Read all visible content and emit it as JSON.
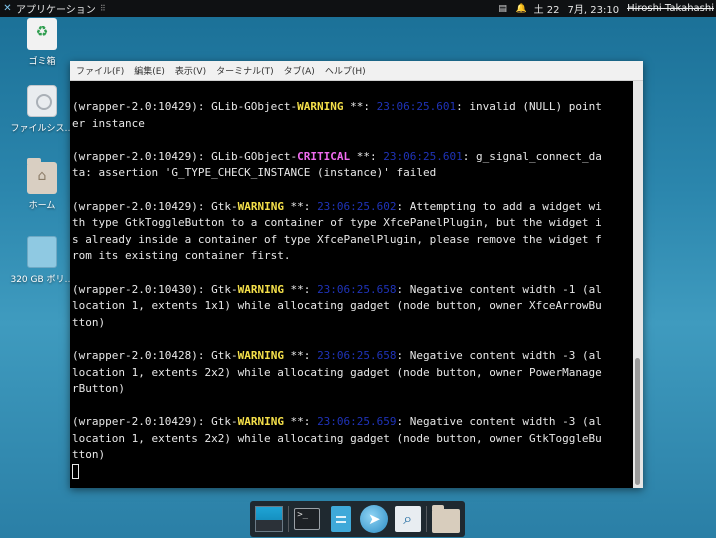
{
  "top_panel": {
    "apps_label": "アプリケーション",
    "workspace_label": "土 22",
    "clock": "7月, 23:10",
    "user": "Hiroshi Takahashi"
  },
  "desktop_icons": [
    {
      "label": "ゴミ箱",
      "icon": "trash-icon"
    },
    {
      "label": "ファイルシス…",
      "icon": "drive-icon"
    },
    {
      "label": "ホーム",
      "icon": "home-folder-icon"
    },
    {
      "label": "320 GB ボリ…",
      "icon": "volume-icon"
    }
  ],
  "terminal": {
    "menu": [
      "ファイル(F)",
      "編集(E)",
      "表示(V)",
      "ターミナル(T)",
      "タブ(A)",
      "ヘルプ(H)"
    ],
    "lines": [
      [
        {
          "t": "(wrapper-2.0:10429): GLib-GObject-"
        },
        {
          "t": "WARNING",
          "c": "warn"
        },
        {
          "t": " **: "
        },
        {
          "t": "23:06:25.601",
          "c": "ts"
        },
        {
          "t": ": invalid (NULL) point"
        }
      ],
      [
        {
          "t": "er instance"
        }
      ],
      [
        {
          "t": ""
        }
      ],
      [
        {
          "t": "(wrapper-2.0:10429): GLib-GObject-"
        },
        {
          "t": "CRITICAL",
          "c": "crit"
        },
        {
          "t": " **: "
        },
        {
          "t": "23:06:25.601",
          "c": "ts"
        },
        {
          "t": ": g_signal_connect_da"
        }
      ],
      [
        {
          "t": "ta: assertion 'G_TYPE_CHECK_INSTANCE (instance)' failed"
        }
      ],
      [
        {
          "t": ""
        }
      ],
      [
        {
          "t": "(wrapper-2.0:10429): Gtk-"
        },
        {
          "t": "WARNING",
          "c": "warn"
        },
        {
          "t": " **: "
        },
        {
          "t": "23:06:25.602",
          "c": "ts"
        },
        {
          "t": ": Attempting to add a widget wi"
        }
      ],
      [
        {
          "t": "th type GtkToggleButton to a container of type XfcePanelPlugin, but the widget i"
        }
      ],
      [
        {
          "t": "s already inside a container of type XfcePanelPlugin, please remove the widget f"
        }
      ],
      [
        {
          "t": "rom its existing container first."
        }
      ],
      [
        {
          "t": ""
        }
      ],
      [
        {
          "t": "(wrapper-2.0:10430): Gtk-"
        },
        {
          "t": "WARNING",
          "c": "warn"
        },
        {
          "t": " **: "
        },
        {
          "t": "23:06:25.658",
          "c": "ts"
        },
        {
          "t": ": Negative content width -1 (al"
        }
      ],
      [
        {
          "t": "location 1, extents 1x1) while allocating gadget (node button, owner XfceArrowBu"
        }
      ],
      [
        {
          "t": "tton)"
        }
      ],
      [
        {
          "t": ""
        }
      ],
      [
        {
          "t": "(wrapper-2.0:10428): Gtk-"
        },
        {
          "t": "WARNING",
          "c": "warn"
        },
        {
          "t": " **: "
        },
        {
          "t": "23:06:25.658",
          "c": "ts"
        },
        {
          "t": ": Negative content width -3 (al"
        }
      ],
      [
        {
          "t": "location 1, extents 2x2) while allocating gadget (node button, owner PowerManage"
        }
      ],
      [
        {
          "t": "rButton)"
        }
      ],
      [
        {
          "t": ""
        }
      ],
      [
        {
          "t": "(wrapper-2.0:10429): Gtk-"
        },
        {
          "t": "WARNING",
          "c": "warn"
        },
        {
          "t": " **: "
        },
        {
          "t": "23:06:25.659",
          "c": "ts"
        },
        {
          "t": ": Negative content width -3 (al"
        }
      ],
      [
        {
          "t": "location 1, extents 2x2) while allocating gadget (node button, owner GtkToggleBu"
        }
      ],
      [
        {
          "t": "tton)"
        }
      ]
    ]
  },
  "dock": {
    "items": [
      "show-desktop-icon",
      "terminal-icon",
      "file-manager-icon",
      "web-browser-icon",
      "app-finder-icon",
      "folder-icon"
    ]
  }
}
